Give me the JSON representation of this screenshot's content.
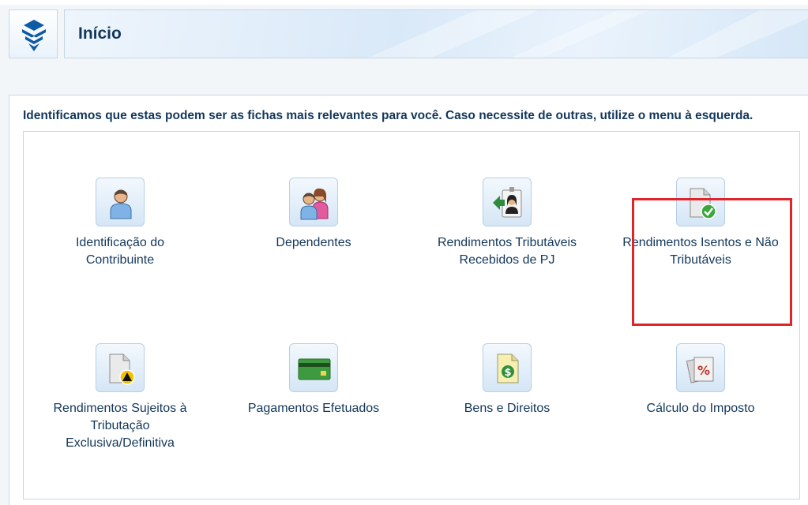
{
  "header": {
    "title": "Início",
    "logo_icon": "receita-federal-logo-icon"
  },
  "main": {
    "intro_text": "Identificamos que estas podem ser as fichas mais relevantes para você. Caso necessite de outras, utilize o menu à esquerda.",
    "items": [
      {
        "label": "Identificação do Contribuinte",
        "icon": "person-icon"
      },
      {
        "label": "Dependentes",
        "icon": "dependents-icon"
      },
      {
        "label": "Rendimentos Tributáveis Recebidos de PJ",
        "icon": "badge-income-icon"
      },
      {
        "label": "Rendimentos Isentos e Não Tributáveis",
        "icon": "document-check-icon"
      },
      {
        "label": "Rendimentos Sujeitos à Tributação Exclusiva/Definitiva",
        "icon": "document-warning-icon"
      },
      {
        "label": "Pagamentos Efetuados",
        "icon": "credit-card-icon"
      },
      {
        "label": "Bens e Direitos",
        "icon": "money-document-icon"
      },
      {
        "label": "Cálculo do Imposto",
        "icon": "tax-percent-icon"
      }
    ],
    "highlighted_item_index": 3
  },
  "colors": {
    "title_text": "#12375b",
    "highlight": "#e0242b",
    "tile_border": "#b6cfe6"
  }
}
